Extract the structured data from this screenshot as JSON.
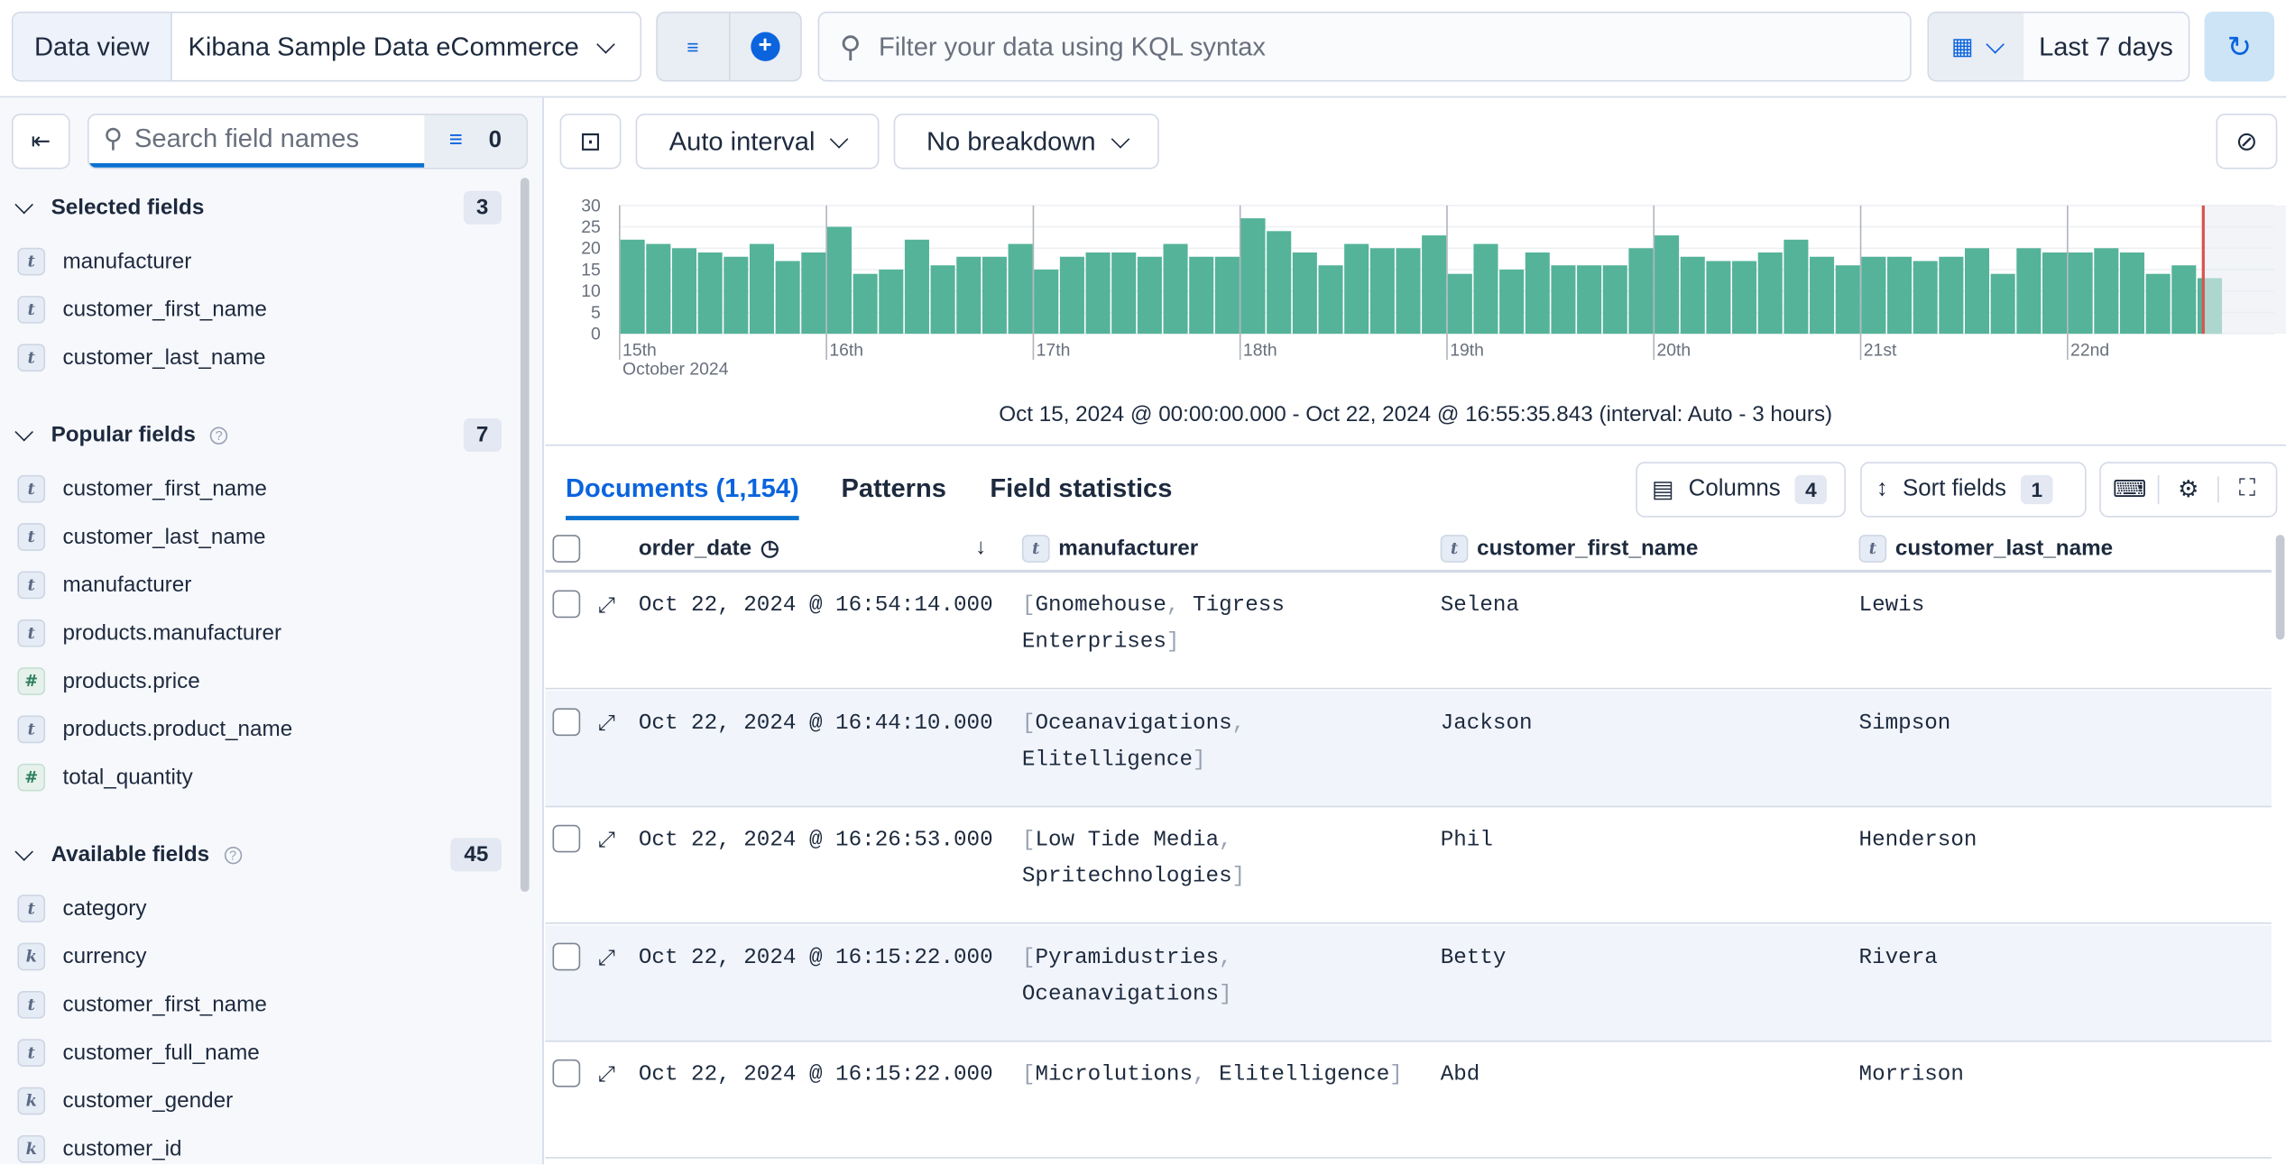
{
  "topbar": {
    "data_view_label": "Data view",
    "data_view_value": "Kibana Sample Data eCommerce",
    "kql_placeholder": "Filter your data using KQL syntax",
    "time_range": "Last 7 days"
  },
  "sidebar": {
    "search_placeholder": "Search field names",
    "filter_count": "0",
    "selected": {
      "title": "Selected fields",
      "count": "3",
      "items": [
        {
          "type": "t",
          "name": "manufacturer"
        },
        {
          "type": "t",
          "name": "customer_first_name"
        },
        {
          "type": "t",
          "name": "customer_last_name"
        }
      ]
    },
    "popular": {
      "title": "Popular fields",
      "count": "7",
      "items": [
        {
          "type": "t",
          "name": "customer_first_name"
        },
        {
          "type": "t",
          "name": "customer_last_name"
        },
        {
          "type": "t",
          "name": "manufacturer"
        },
        {
          "type": "t",
          "name": "products.manufacturer"
        },
        {
          "type": "#",
          "name": "products.price"
        },
        {
          "type": "t",
          "name": "products.product_name"
        },
        {
          "type": "#",
          "name": "total_quantity"
        }
      ]
    },
    "available": {
      "title": "Available fields",
      "count": "45",
      "items": [
        {
          "type": "t",
          "name": "category"
        },
        {
          "type": "k",
          "name": "currency"
        },
        {
          "type": "t",
          "name": "customer_first_name"
        },
        {
          "type": "t",
          "name": "customer_full_name"
        },
        {
          "type": "k",
          "name": "customer_gender"
        },
        {
          "type": "k",
          "name": "customer_id"
        }
      ]
    }
  },
  "toolbar": {
    "interval": "Auto interval",
    "breakdown": "No breakdown"
  },
  "chart_data": {
    "type": "bar",
    "ylim": [
      0,
      30
    ],
    "yticks": [
      "0",
      "5",
      "10",
      "15",
      "20",
      "25",
      "30"
    ],
    "xticks": [
      "15th",
      "16th",
      "17th",
      "18th",
      "19th",
      "20th",
      "21st",
      "22nd"
    ],
    "xsublabel": "October 2024",
    "bar_interval": "3 hours",
    "color": "#54b399",
    "values": [
      22,
      21,
      20,
      19,
      18,
      21,
      17,
      19,
      25,
      14,
      15,
      22,
      16,
      18,
      18,
      21,
      15,
      18,
      19,
      19,
      18,
      21,
      18,
      18,
      27,
      24,
      19,
      16,
      21,
      20,
      20,
      23,
      14,
      21,
      15,
      19,
      16,
      16,
      16,
      20,
      23,
      18,
      17,
      17,
      19,
      22,
      18,
      16,
      18,
      18,
      17,
      18,
      20,
      14,
      20,
      19,
      19,
      20,
      19,
      14,
      16,
      13
    ]
  },
  "time_summary": "Oct 15, 2024 @ 00:00:00.000 - Oct 22, 2024 @ 16:55:35.843 (interval: Auto - 3 hours)",
  "tabs": [
    {
      "label": "Documents (1,154)"
    },
    {
      "label": "Patterns"
    },
    {
      "label": "Field statistics"
    }
  ],
  "controls": {
    "columns_label": "Columns",
    "columns_count": "4",
    "sort_label": "Sort fields",
    "sort_count": "1"
  },
  "table": {
    "columns": [
      "order_date",
      "manufacturer",
      "customer_first_name",
      "customer_last_name"
    ],
    "rows": [
      {
        "date": "Oct 22, 2024 @ 16:54:14.000",
        "m1": "Gnomehouse",
        "m2": "Tigress",
        "m3": "Enterprises",
        "first": "Selena",
        "last": "Lewis"
      },
      {
        "date": "Oct 22, 2024 @ 16:44:10.000",
        "m1": "Oceanavigations",
        "m2": "",
        "m3": "Elitelligence",
        "first": "Jackson",
        "last": "Simpson"
      },
      {
        "date": "Oct 22, 2024 @ 16:26:53.000",
        "m1": "Low Tide Media",
        "m2": "",
        "m3": "Spritechnologies",
        "first": "Phil",
        "last": "Henderson"
      },
      {
        "date": "Oct 22, 2024 @ 16:15:22.000",
        "m1": "Pyramidustries",
        "m2": "",
        "m3": "Oceanavigations",
        "first": "Betty",
        "last": "Rivera"
      },
      {
        "date": "Oct 22, 2024 @ 16:15:22.000",
        "m1": "Microlutions",
        "m2": "Elitelligence",
        "m3": "",
        "first": "Abd",
        "last": "Morrison"
      }
    ]
  }
}
